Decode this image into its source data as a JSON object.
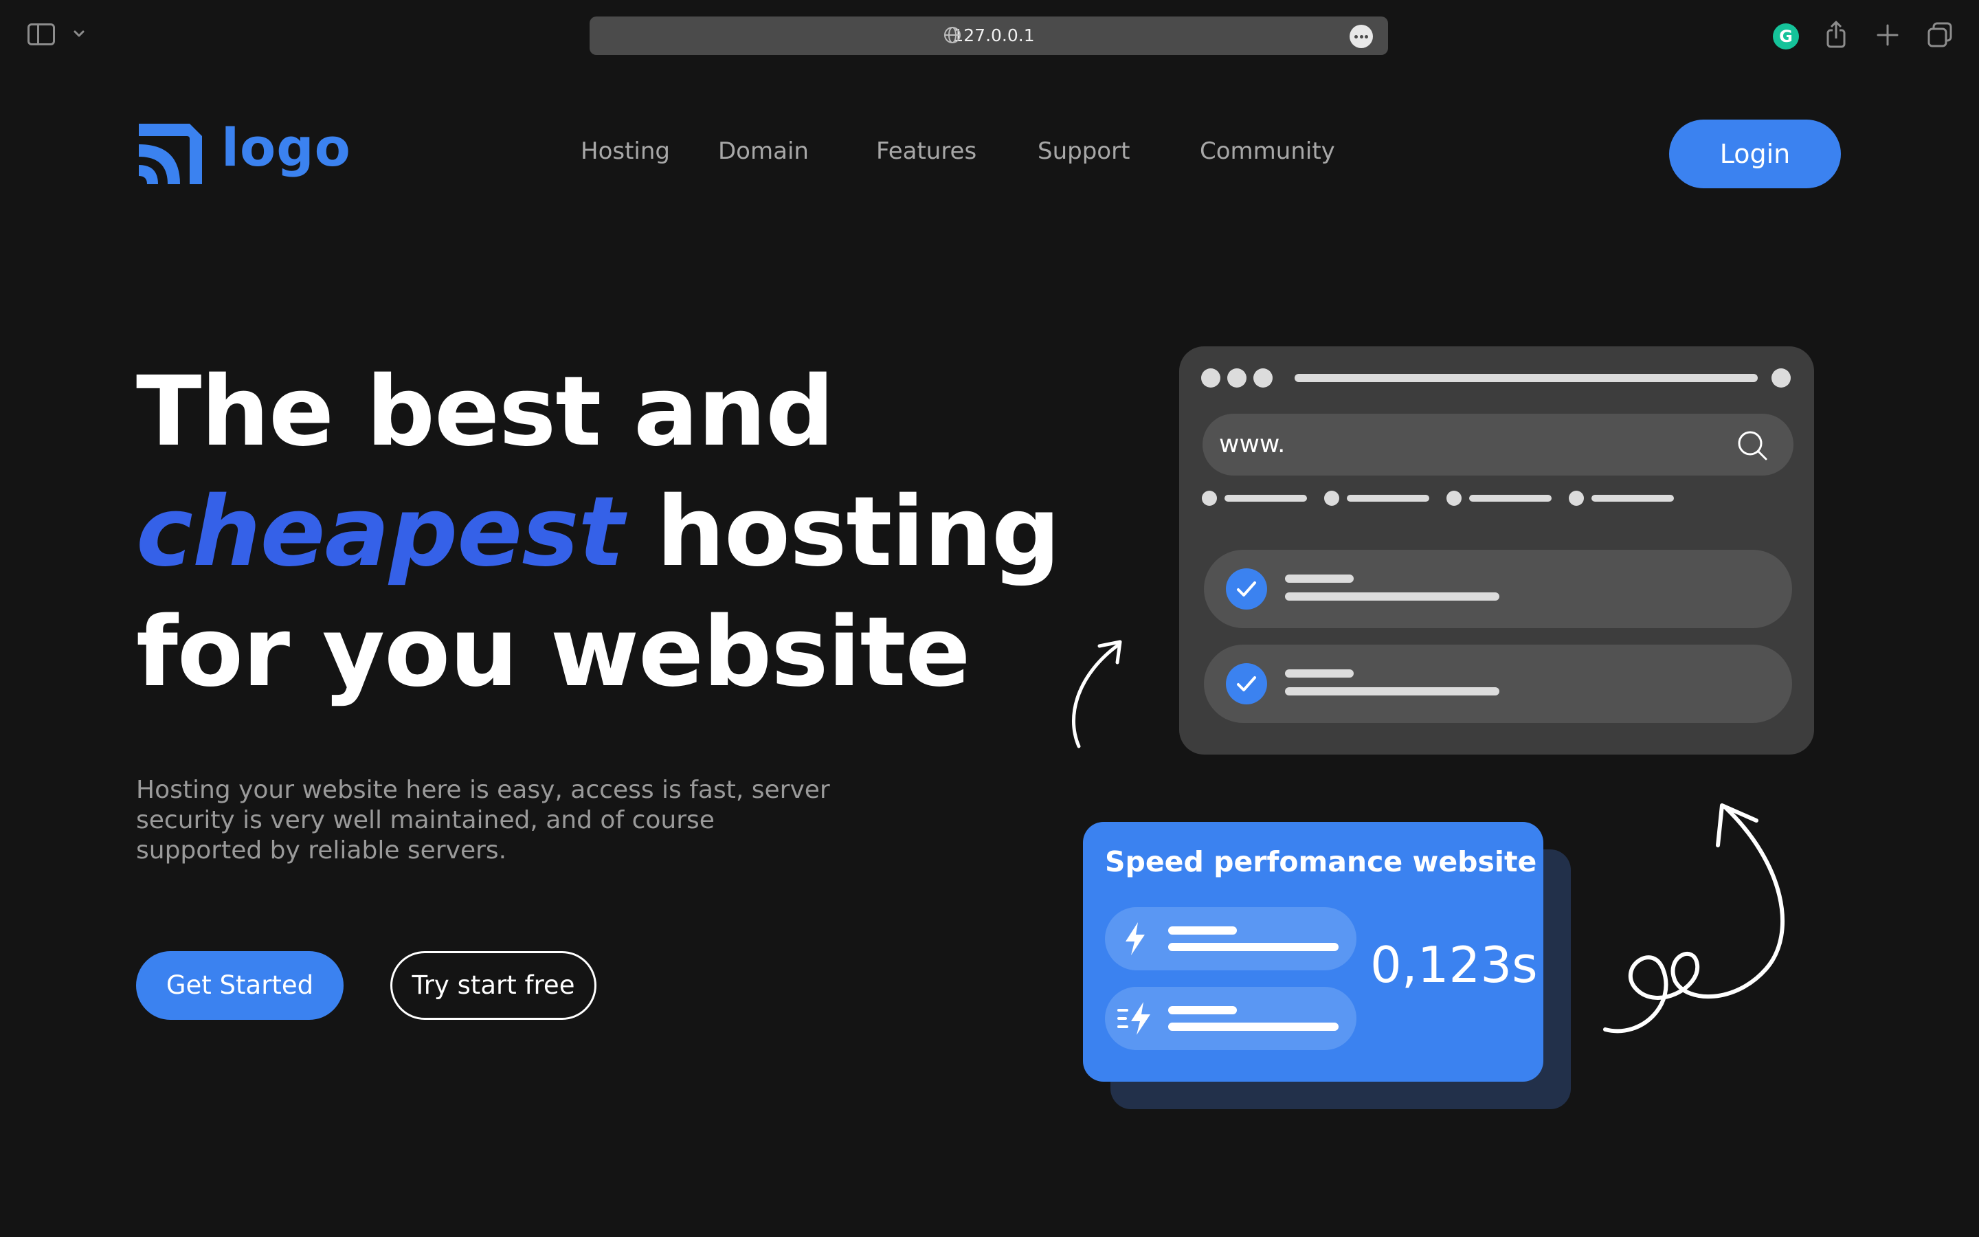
{
  "browser": {
    "url": "127.0.0.1"
  },
  "header": {
    "logo_text": "logo",
    "nav": [
      "Hosting",
      "Domain",
      "Features",
      "Support",
      "Community"
    ],
    "login_label": "Login"
  },
  "hero": {
    "line1": "The best and",
    "line2_accent": "cheapest",
    "line2_rest": "hosting",
    "line3": "for you website",
    "description": "Hosting your website here is easy, access is fast, server security is very well maintained, and of course supported by reliable servers.",
    "primary_button": "Get Started",
    "secondary_button": "Try start free"
  },
  "illustration": {
    "search_text": "www.",
    "card_title": "Speed perfomance website",
    "card_value": "0,123s"
  },
  "colors": {
    "background": "#141414",
    "accent": "#3b82f0",
    "accent_headline": "#3561e8",
    "mockup": "#3d3d3d"
  },
  "icons": [
    "sidebar-icon",
    "chevron-down-icon",
    "globe-icon",
    "more-icon",
    "grammarly-icon",
    "share-icon",
    "plus-icon",
    "tabs-icon",
    "logo-icon",
    "search-icon",
    "check-icon",
    "lightning-icon",
    "fast-lightning-icon"
  ]
}
